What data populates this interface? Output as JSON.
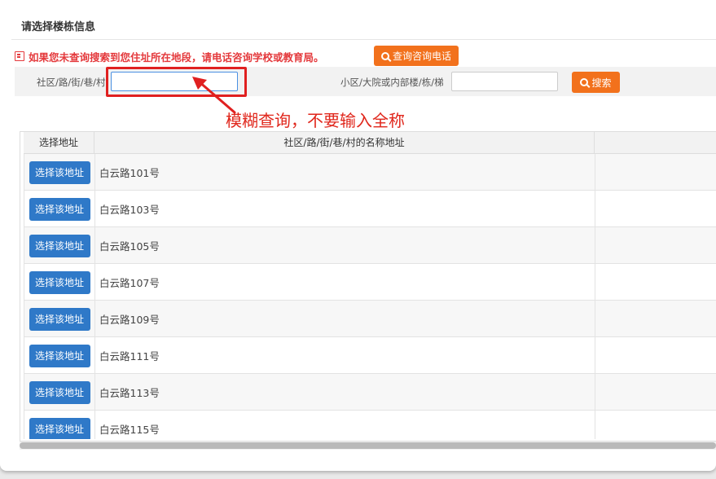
{
  "dialog": {
    "title": "请选择楼栋信息"
  },
  "notice": {
    "text": "如果您未查询搜索到您住址所在地段，请电话咨询学校或教育局。",
    "button_label": "查询咨询电话",
    "icon": "notice-icon"
  },
  "search": {
    "community_label": "社区/路/街/巷/村",
    "community_value": "",
    "court_label": "小区/大院或内部楼/栋/梯",
    "court_value": "",
    "search_button_label": "搜索",
    "search_icon": "search-icon"
  },
  "annotation": {
    "text": "模糊查询，不要输入全称",
    "color": "#e0261b"
  },
  "table": {
    "columns": [
      "选择地址",
      "社区/路/街/巷/村的名称地址",
      ""
    ],
    "rows": [
      {
        "button": "选择该地址",
        "address": "白云路101号"
      },
      {
        "button": "选择该地址",
        "address": "白云路103号"
      },
      {
        "button": "选择该地址",
        "address": "白云路105号"
      },
      {
        "button": "选择该地址",
        "address": "白云路107号"
      },
      {
        "button": "选择该地址",
        "address": "白云路109号"
      },
      {
        "button": "选择该地址",
        "address": "白云路111号"
      },
      {
        "button": "选择该地址",
        "address": "白云路113号"
      },
      {
        "button": "选择该地址",
        "address": "白云路115号"
      }
    ]
  },
  "colors": {
    "accent_orange": "#f2711c",
    "button_blue": "#2f79c8",
    "notice_red": "#e4393c"
  }
}
